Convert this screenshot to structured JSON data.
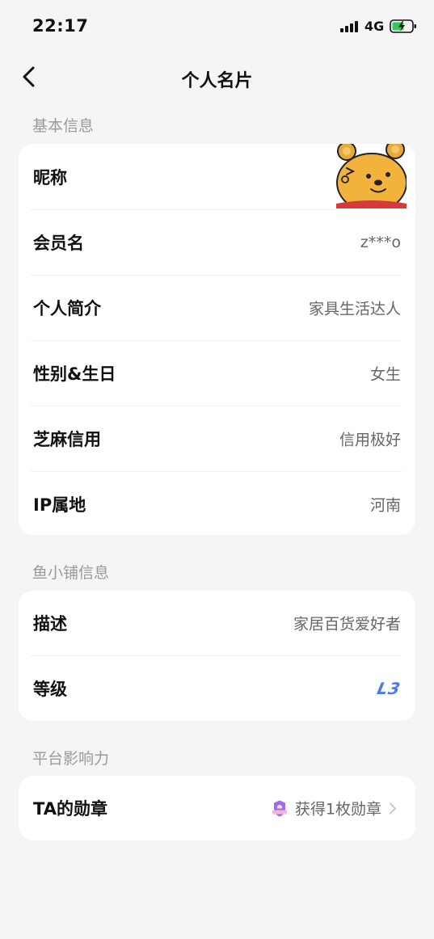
{
  "status_bar": {
    "time": "22:17",
    "network": "4G"
  },
  "nav": {
    "title": "个人名片"
  },
  "sections": {
    "basic": {
      "title": "基本信息"
    },
    "shop": {
      "title": "鱼小铺信息"
    },
    "influence": {
      "title": "平台影响力"
    }
  },
  "basic_rows": [
    {
      "label": "昵称",
      "value": ""
    },
    {
      "label": "会员名",
      "value": "z***o"
    },
    {
      "label": "个人简介",
      "value": "家具生活达人"
    },
    {
      "label": "性别&生日",
      "value": "女生"
    },
    {
      "label": "芝麻信用",
      "value": "信用极好"
    },
    {
      "label": "IP属地",
      "value": "河南"
    }
  ],
  "shop_rows": [
    {
      "label": "描述",
      "value": "家居百货爱好者"
    },
    {
      "label": "等级",
      "value": "L3"
    }
  ],
  "influence_rows": [
    {
      "label": "TA的勋章",
      "value": "获得1枚勋章"
    }
  ],
  "colors": {
    "accent_level": "#4a7af0",
    "background": "#f5f5f5",
    "card": "#ffffff"
  },
  "icons": {
    "back": "chevron-left-icon",
    "avatar": "bear-avatar",
    "medal": "medal-icon",
    "chevron": "chevron-right-icon"
  }
}
